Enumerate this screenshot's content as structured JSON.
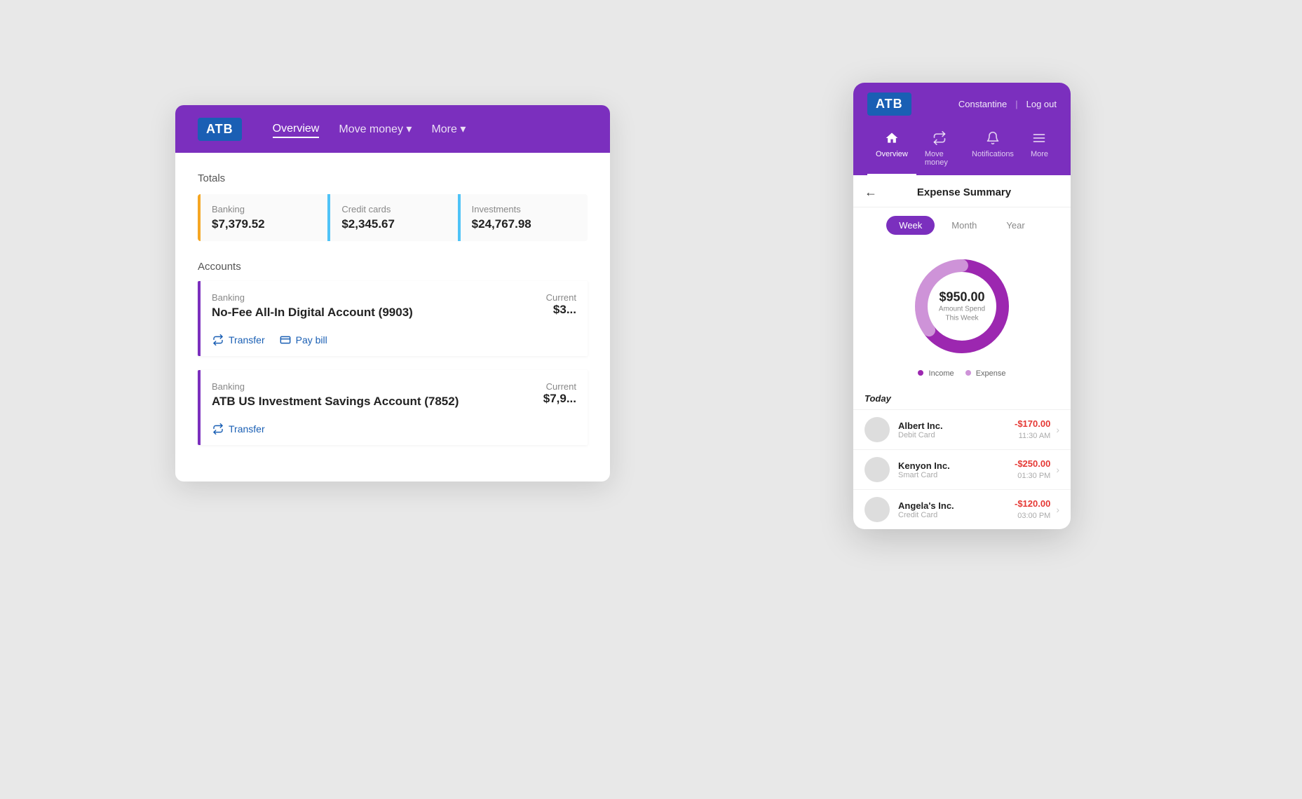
{
  "app": {
    "logo": "ATB"
  },
  "desktop": {
    "nav": [
      {
        "label": "Overview",
        "active": true
      },
      {
        "label": "Move money ▾",
        "active": false
      },
      {
        "label": "More ▾",
        "active": false
      }
    ],
    "totals_title": "Totals",
    "totals": [
      {
        "label": "Banking",
        "amount": "$7,379.52",
        "color": "#f5a623"
      },
      {
        "label": "Credit cards",
        "amount": "$2,345.67",
        "color": "#4fc3f7"
      },
      {
        "label": "Investments",
        "amount": "$24,767.98",
        "color": "#4fc3f7"
      }
    ],
    "accounts_title": "Accounts",
    "accounts": [
      {
        "type": "Banking",
        "balance_label": "Current",
        "name": "No-Fee All-In Digital Account (9903)",
        "balance": "$3...",
        "actions": [
          "Transfer",
          "Pay bill"
        ]
      },
      {
        "type": "Banking",
        "balance_label": "Current",
        "name": "ATB US Investment Savings Account (7852)",
        "balance": "$7,9...",
        "actions": [
          "Transfer"
        ]
      }
    ]
  },
  "mobile": {
    "header": {
      "user": "Constantine",
      "logout": "Log out"
    },
    "nav": [
      {
        "label": "Overview",
        "icon": "⌂",
        "active": true
      },
      {
        "label": "Move money",
        "icon": "⇄",
        "active": false
      },
      {
        "label": "Notifications",
        "icon": "🔔",
        "active": false
      },
      {
        "label": "More",
        "icon": "≡",
        "active": false
      }
    ],
    "expense_summary": {
      "title": "Expense Summary",
      "time_tabs": [
        {
          "label": "Week",
          "active": true
        },
        {
          "label": "Month",
          "active": false
        },
        {
          "label": "Year",
          "active": false
        }
      ],
      "donut": {
        "amount": "$950.00",
        "label": "Amount Spend This Week",
        "income_pct": 65,
        "expense_pct": 35,
        "income_color": "#9c27b0",
        "expense_color": "#ce93d8"
      },
      "legend": [
        {
          "label": "Income",
          "color": "#9c27b0"
        },
        {
          "label": "Expense",
          "color": "#ce93d8"
        }
      ],
      "today_label": "Today",
      "transactions": [
        {
          "name": "Albert Inc.",
          "sub": "Debit Card",
          "amount": "-$170.00",
          "time": "11:30 AM"
        },
        {
          "name": "Kenyon Inc.",
          "sub": "Smart Card",
          "amount": "-$250.00",
          "time": "01:30 PM"
        },
        {
          "name": "Angela's Inc.",
          "sub": "Credit Card",
          "amount": "-$120.00",
          "time": "03:00 PM"
        }
      ]
    }
  }
}
